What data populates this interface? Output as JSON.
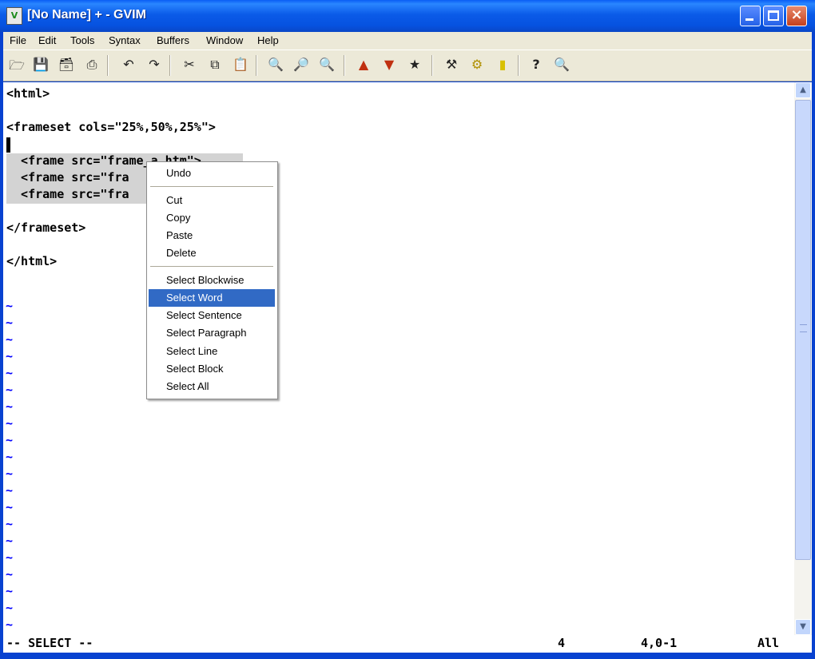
{
  "window": {
    "title": "[No Name] + - GVIM",
    "icon_label": "V"
  },
  "menubar": [
    "File",
    "Edit",
    "Tools",
    "Syntax",
    "Buffers",
    "Window",
    "Help"
  ],
  "toolbar_icons": [
    "open-icon",
    "save-icon",
    "save-all-icon",
    "print-icon",
    "undo-icon",
    "redo-icon",
    "cut-icon",
    "copy-icon",
    "paste-icon",
    "find-icon",
    "find-next-icon",
    "find-prev-icon",
    "load-session-icon",
    "save-session-icon",
    "run-script-icon",
    "make-icon",
    "build-tags-icon",
    "jump-tag-icon",
    "help-icon",
    "find-help-icon"
  ],
  "editor": {
    "lines": [
      "<html>",
      "",
      "<frameset cols=\"25%,50%,25%\">",
      "",
      "  <frame src=\"frame_a.htm\">",
      "  <frame src=\"fra",
      "  <frame src=\"fra",
      "",
      "</frameset>",
      "",
      "</html>",
      ""
    ],
    "tilde": "~"
  },
  "context_menu": {
    "items": [
      "Undo",
      "Cut",
      "Copy",
      "Paste",
      "Delete",
      "Select Blockwise",
      "Select Word",
      "Select Sentence",
      "Select Paragraph",
      "Select Line",
      "Select Block",
      "Select All"
    ],
    "highlighted": "Select Word"
  },
  "status": {
    "mode": "-- SELECT --",
    "selected_count": "4",
    "position": "4,0-1",
    "scroll": "All"
  },
  "colors": {
    "titlebar": "#0a5ef5",
    "menu_highlight": "#316ac5",
    "tilde": "#0000ff",
    "selection": "#d3d3d3"
  }
}
